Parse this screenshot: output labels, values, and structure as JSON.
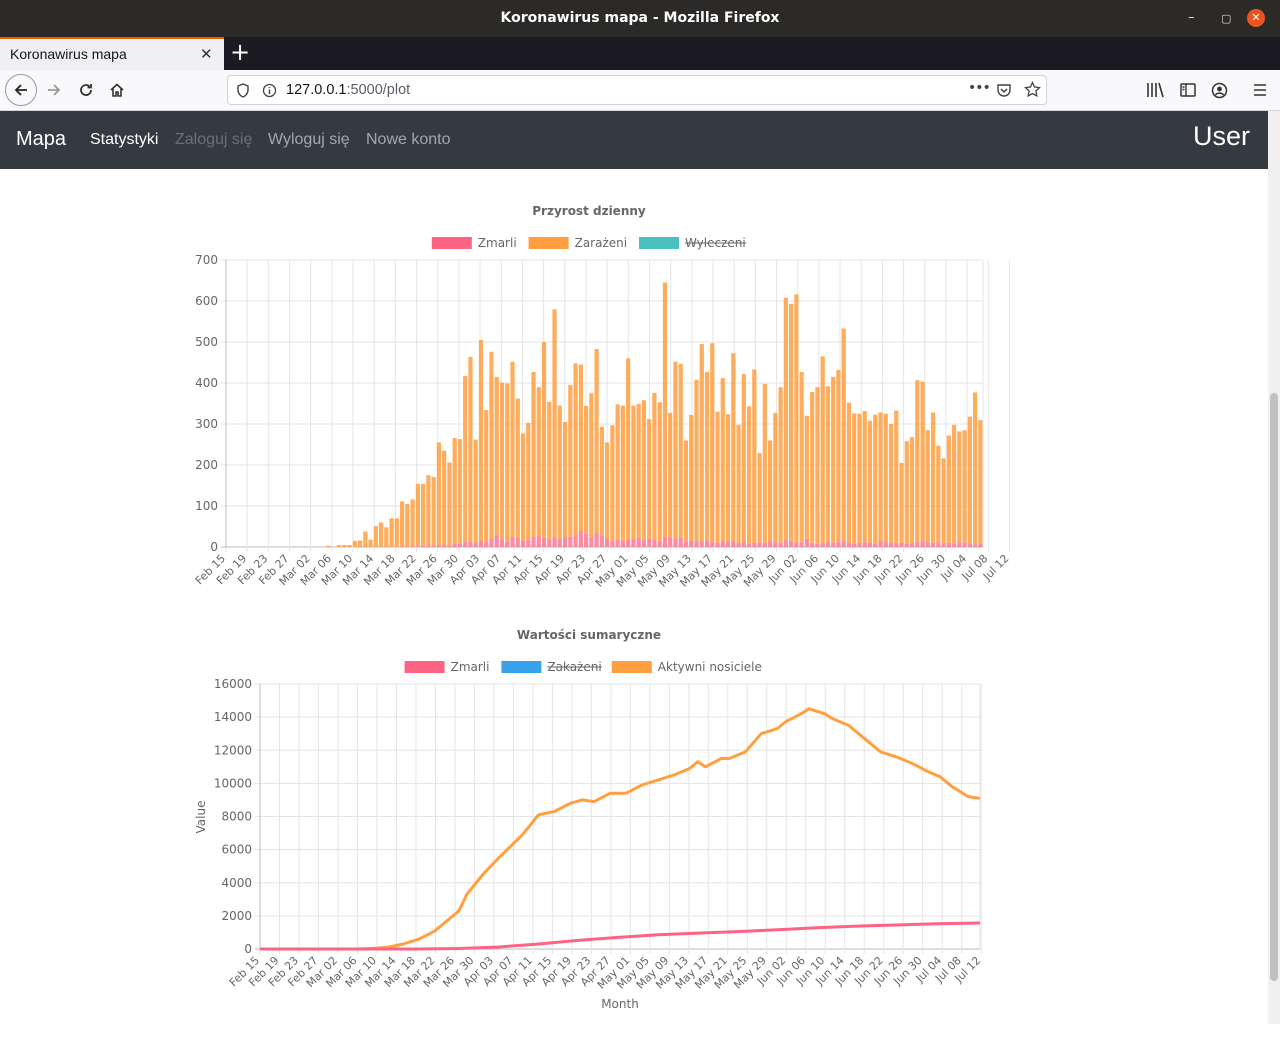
{
  "window": {
    "title": "Koronawirus mapa - Mozilla Firefox",
    "minimize": "–",
    "maximize": "▢",
    "close": "✕"
  },
  "browser": {
    "tab_title": "Koronawirus mapa",
    "tab_close": "✕",
    "new_tab": "+",
    "url_host": "127.0.0.1",
    "url_path": ":5000/plot",
    "back_icon": "arrow-left-icon",
    "forward_icon": "arrow-right-icon",
    "reload_icon": "reload-icon",
    "home_icon": "home-icon",
    "more_icon": "•••"
  },
  "page_nav": {
    "brand": "Mapa",
    "links": [
      {
        "label": "Statystyki",
        "state": "active"
      },
      {
        "label": "Zaloguj się",
        "state": "disabled"
      },
      {
        "label": "Wyloguj się",
        "state": "normal"
      },
      {
        "label": "Nowe konto",
        "state": "normal"
      }
    ],
    "user": "User"
  },
  "colors": {
    "red": "#ff6384",
    "orange": "#ff9f40",
    "teal": "#4bc0c0",
    "blue": "#36a2eb"
  },
  "chart_data": [
    {
      "type": "bar",
      "title": "Przyrost  dzienny",
      "legend": [
        {
          "name": "Zmarli",
          "color": "#ff6384",
          "hidden": false
        },
        {
          "name": "Zarażeni",
          "color": "#ff9f40",
          "hidden": false
        },
        {
          "name": "Wyleczeni",
          "color": "#4bc0c0",
          "hidden": true
        }
      ],
      "stacked": true,
      "start_date": "Feb 15",
      "tick_labels": [
        "Feb 15",
        "Feb 19",
        "Feb 23",
        "Feb 27",
        "Mar 02",
        "Mar 06",
        "Mar 10",
        "Mar 14",
        "Mar 18",
        "Mar 22",
        "Mar 26",
        "Mar 30",
        "Apr 03",
        "Apr 07",
        "Apr 11",
        "Apr 15",
        "Apr 19",
        "Apr 23",
        "Apr 27",
        "May 01",
        "May 05",
        "May 09",
        "May 13",
        "May 17",
        "May 21",
        "May 25",
        "May 29",
        "Jun 02",
        "Jun 06",
        "Jun 10",
        "Jun 14",
        "Jun 18",
        "Jun 22",
        "Jun 26",
        "Jun 30",
        "Jul 04",
        "Jul 08",
        "Jul 12"
      ],
      "ylim": [
        0,
        700
      ],
      "yticks": [
        0,
        100,
        200,
        300,
        400,
        500,
        600,
        700
      ],
      "series": [
        {
          "name": "Zarażeni",
          "values": [
            0,
            0,
            0,
            0,
            0,
            0,
            0,
            0,
            0,
            0,
            0,
            0,
            0,
            0,
            0,
            0,
            0,
            0,
            0,
            3,
            0,
            5,
            5,
            5,
            15,
            16,
            38,
            18,
            51,
            60,
            48,
            70,
            70,
            110,
            105,
            115,
            152,
            152,
            172,
            168,
            250,
            230,
            202,
            258,
            255,
            405,
            450,
            252,
            490,
            322,
            456,
            385,
            383,
            385,
            427,
            340,
            262,
            285,
            402,
            362,
            478,
            336,
            556,
            325,
            281,
            370,
            418,
            405,
            312,
            350,
            448,
            265,
            235,
            282,
            330,
            330,
            442,
            325,
            327,
            340,
            292,
            358,
            338,
            620,
            305,
            432,
            425,
            248,
            307,
            393,
            483,
            412,
            485,
            320,
            397,
            312,
            458,
            288,
            410,
            335,
            423,
            217,
            388,
            245,
            315,
            380,
            590,
            578,
            606,
            415,
            300,
            368,
            382,
            455,
            380,
            405,
            420,
            518,
            342,
            318,
            315,
            320,
            298,
            315,
            313,
            313,
            290,
            325,
            195,
            250,
            258,
            395,
            388,
            273,
            318,
            235,
            208,
            262,
            290,
            270,
            275,
            310,
            371,
            302
          ]
        },
        {
          "name": "Zmarli",
          "values": [
            0,
            0,
            0,
            0,
            0,
            0,
            0,
            0,
            0,
            0,
            0,
            0,
            0,
            0,
            0,
            0,
            0,
            0,
            0,
            0,
            0,
            0,
            0,
            0,
            0,
            0,
            0,
            0,
            0,
            0,
            0,
            0,
            0,
            1,
            0,
            1,
            2,
            2,
            3,
            3,
            5,
            5,
            4,
            8,
            8,
            12,
            14,
            10,
            15,
            12,
            20,
            30,
            18,
            14,
            25,
            22,
            15,
            18,
            25,
            28,
            22,
            18,
            24,
            20,
            24,
            25,
            30,
            40,
            32,
            25,
            35,
            28,
            20,
            15,
            18,
            15,
            18,
            20,
            22,
            18,
            20,
            18,
            15,
            25,
            22,
            20,
            22,
            12,
            15,
            15,
            12,
            15,
            12,
            10,
            15,
            12,
            15,
            10,
            12,
            8,
            10,
            12,
            10,
            15,
            12,
            10,
            18,
            15,
            10,
            12,
            20,
            10,
            8,
            10,
            12,
            10,
            12,
            15,
            10,
            8,
            10,
            12,
            10,
            8,
            15,
            12,
            10,
            8,
            10,
            8,
            10,
            12,
            15,
            12,
            10,
            12,
            8,
            10,
            8,
            12,
            10,
            8,
            6,
            8
          ]
        }
      ]
    },
    {
      "type": "line",
      "title": "Wartości  sumaryczne",
      "legend": [
        {
          "name": "Zmarli",
          "color": "#ff6384",
          "hidden": false
        },
        {
          "name": "Zakażeni",
          "color": "#36a2eb",
          "hidden": true
        },
        {
          "name": "Aktywni nosiciele",
          "color": "#ff9f40",
          "hidden": false
        }
      ],
      "xlabel": "Month",
      "ylabel": "Value",
      "tick_labels": [
        "Feb 15",
        "Feb 19",
        "Feb 23",
        "Feb 27",
        "Mar 02",
        "Mar 06",
        "Mar 10",
        "Mar 14",
        "Mar 18",
        "Mar 22",
        "Mar 26",
        "Mar 30",
        "Apr 03",
        "Apr 07",
        "Apr 11",
        "Apr 15",
        "Apr 19",
        "Apr 23",
        "Apr 27",
        "May 01",
        "May 05",
        "May 09",
        "May 13",
        "May 17",
        "May 21",
        "May 25",
        "May 29",
        "Jun 02",
        "Jun 06",
        "Jun 10",
        "Jun 14",
        "Jun 18",
        "Jun 22",
        "Jun 26",
        "Jun 30",
        "Jul 04",
        "Jul 08",
        "Jul 12"
      ],
      "ylim": [
        0,
        16000
      ],
      "yticks": [
        0,
        2000,
        4000,
        6000,
        8000,
        10000,
        12000,
        14000,
        16000
      ],
      "series": [
        {
          "name": "Aktywni nosiciele",
          "points": [
            [
              0,
              0
            ],
            [
              24,
              0
            ],
            [
              28,
              30
            ],
            [
              32,
              100
            ],
            [
              36,
              300
            ],
            [
              40,
              600
            ],
            [
              44,
              1100
            ],
            [
              47,
              1700
            ],
            [
              50,
              2300
            ],
            [
              52,
              3300
            ],
            [
              56,
              4500
            ],
            [
              60,
              5500
            ],
            [
              63,
              6200
            ],
            [
              66,
              6900
            ],
            [
              69,
              7800
            ],
            [
              70,
              8100
            ],
            [
              74,
              8300
            ],
            [
              78,
              8800
            ],
            [
              81,
              9000
            ],
            [
              84,
              8900
            ],
            [
              88,
              9400
            ],
            [
              92,
              9400
            ],
            [
              96,
              9900
            ],
            [
              100,
              10200
            ],
            [
              104,
              10500
            ],
            [
              108,
              10900
            ],
            [
              110,
              11300
            ],
            [
              112,
              11000
            ],
            [
              116,
              11500
            ],
            [
              118,
              11500
            ],
            [
              122,
              11900
            ],
            [
              126,
              13000
            ],
            [
              130,
              13300
            ],
            [
              132,
              13700
            ],
            [
              136,
              14200
            ],
            [
              138,
              14500
            ],
            [
              142,
              14200
            ],
            [
              144,
              13900
            ],
            [
              148,
              13500
            ],
            [
              152,
              12700
            ],
            [
              156,
              11900
            ],
            [
              160,
              11600
            ],
            [
              164,
              11200
            ],
            [
              168,
              10700
            ],
            [
              171,
              10400
            ],
            [
              174,
              9800
            ],
            [
              178,
              9200
            ],
            [
              181,
              9100
            ]
          ]
        },
        {
          "name": "Zmarli",
          "points": [
            [
              0,
              0
            ],
            [
              40,
              0
            ],
            [
              50,
              30
            ],
            [
              60,
              120
            ],
            [
              70,
              300
            ],
            [
              80,
              520
            ],
            [
              90,
              700
            ],
            [
              100,
              860
            ],
            [
              110,
              960
            ],
            [
              120,
              1050
            ],
            [
              130,
              1160
            ],
            [
              140,
              1280
            ],
            [
              150,
              1380
            ],
            [
              160,
              1450
            ],
            [
              170,
              1520
            ],
            [
              181,
              1570
            ]
          ]
        }
      ]
    }
  ]
}
